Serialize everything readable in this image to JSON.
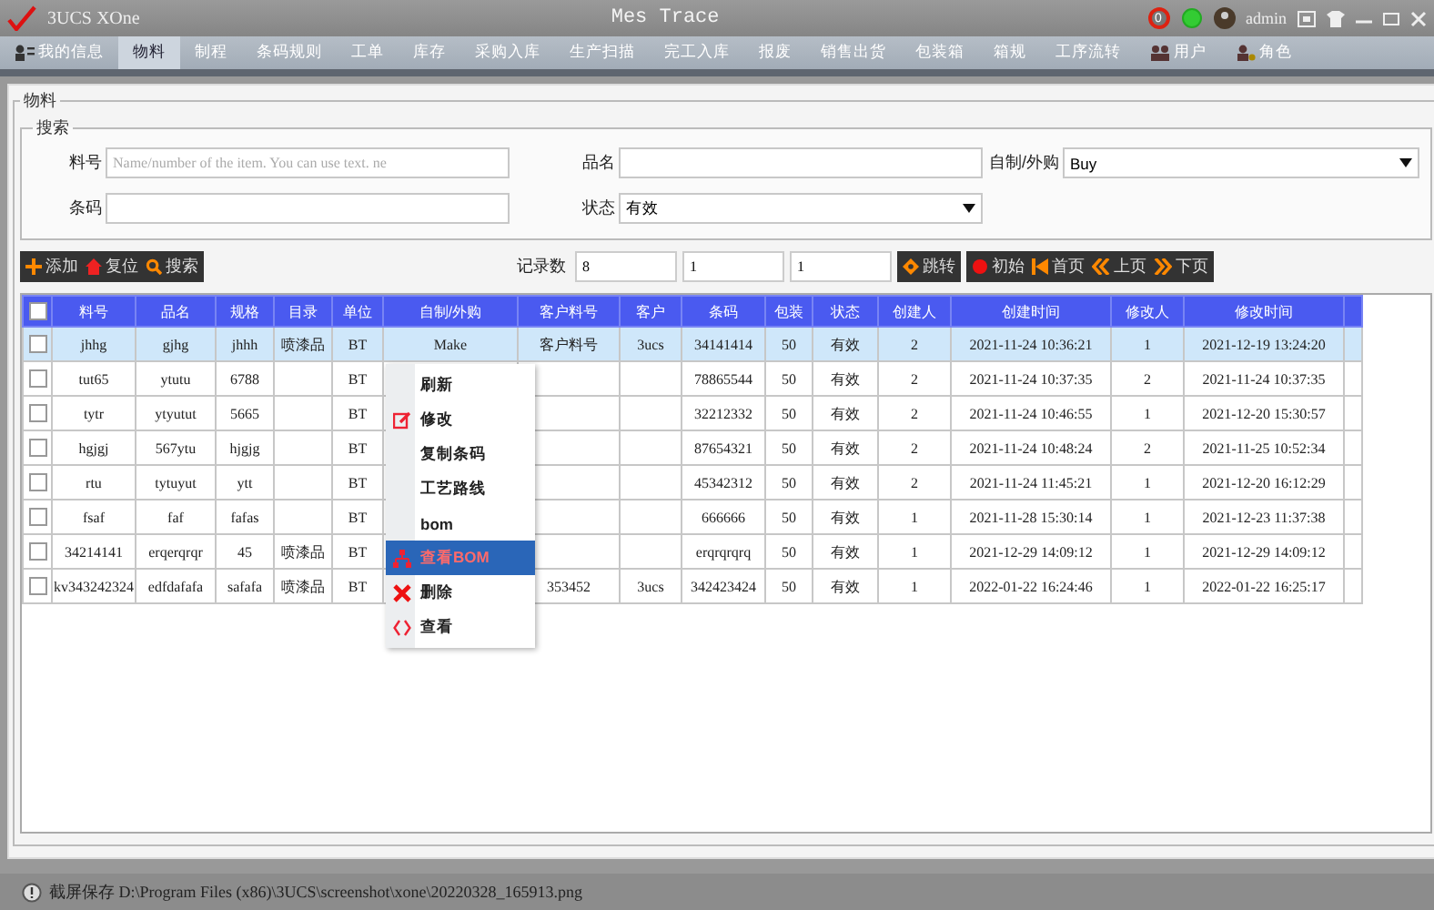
{
  "window": {
    "app_name": "3UCS XOne",
    "title": "Mes Trace",
    "notification_count": "0",
    "user": "admin"
  },
  "tabs": [
    {
      "label": "我的信息",
      "selected": false,
      "kind": "user"
    },
    {
      "label": "物料",
      "selected": true,
      "kind": "plain"
    },
    {
      "label": "制程",
      "selected": false,
      "kind": "plain"
    },
    {
      "label": "条码规则",
      "selected": false,
      "kind": "plain"
    },
    {
      "label": "工单",
      "selected": false,
      "kind": "plain"
    },
    {
      "label": "库存",
      "selected": false,
      "kind": "plain"
    },
    {
      "label": "采购入库",
      "selected": false,
      "kind": "plain"
    },
    {
      "label": "生产扫描",
      "selected": false,
      "kind": "plain"
    },
    {
      "label": "完工入库",
      "selected": false,
      "kind": "plain"
    },
    {
      "label": "报废",
      "selected": false,
      "kind": "plain"
    },
    {
      "label": "销售出货",
      "selected": false,
      "kind": "plain"
    },
    {
      "label": "包装箱",
      "selected": false,
      "kind": "plain"
    },
    {
      "label": "箱规",
      "selected": false,
      "kind": "plain"
    },
    {
      "label": "工序流转",
      "selected": false,
      "kind": "plain"
    },
    {
      "label": "用户",
      "selected": false,
      "kind": "users"
    },
    {
      "label": "角色",
      "selected": false,
      "kind": "role"
    }
  ],
  "panel": {
    "title": "物料",
    "search_title": "搜索",
    "fields": [
      {
        "label": "料号",
        "placeholder": "Name/number of the item. You can use text. ne",
        "kind": "text"
      },
      {
        "label": "品名",
        "kind": "text"
      },
      {
        "label": "自制/外购",
        "value": "Buy",
        "kind": "select"
      },
      {
        "label": "条码",
        "kind": "text"
      },
      {
        "label": "状态",
        "value": "有效",
        "kind": "select"
      }
    ]
  },
  "toolbar": {
    "buttons": [
      {
        "label": "添加",
        "kind": "add"
      },
      {
        "label": "复位",
        "kind": "reset"
      },
      {
        "label": "搜索",
        "kind": "search"
      }
    ],
    "record_label": "记录数",
    "record_count": "8",
    "page_size": "1",
    "page": "1",
    "jump": {
      "label": "跳转",
      "kind": "jump"
    },
    "pager": [
      {
        "label": "初始",
        "kind": "init"
      },
      {
        "label": "首页",
        "kind": "first"
      },
      {
        "label": "上页",
        "kind": "prev"
      },
      {
        "label": "下页",
        "kind": "next"
      }
    ]
  },
  "table": {
    "all_checked": false,
    "columns": [
      "料号",
      "品名",
      "规格",
      "目录",
      "单位",
      "自制/外购",
      "客户料号",
      "客户",
      "条码",
      "包装",
      "状态",
      "创建人",
      "创建时间",
      "修改人",
      "修改时间"
    ],
    "rows": [
      {
        "selected": true,
        "checked": false,
        "cells": [
          "jhhg",
          "gjhg",
          "jhhh",
          "喷漆品",
          "BT",
          "Make",
          "客户料号",
          "3ucs",
          "34141414",
          "50",
          "有效",
          "2",
          "2021-11-24 10:36:21",
          "1",
          "2021-12-19 13:24:20"
        ]
      },
      {
        "selected": false,
        "checked": false,
        "cells": [
          "tut65",
          "ytutu",
          "6788",
          null,
          "BT",
          null,
          null,
          null,
          "78865544",
          "50",
          "有效",
          "2",
          "2021-11-24 10:37:35",
          "2",
          "2021-11-24 10:37:35"
        ]
      },
      {
        "selected": false,
        "checked": false,
        "cells": [
          "tytr",
          "ytyutut",
          "5665",
          null,
          "BT",
          null,
          null,
          null,
          "32212332",
          "50",
          "有效",
          "2",
          "2021-11-24 10:46:55",
          "1",
          "2021-12-20 15:30:57"
        ]
      },
      {
        "selected": false,
        "checked": false,
        "cells": [
          "hgjgj",
          "567ytu",
          "hjgjg",
          null,
          "BT",
          null,
          null,
          null,
          "87654321",
          "50",
          "有效",
          "2",
          "2021-11-24 10:48:24",
          "2",
          "2021-11-25 10:52:34"
        ]
      },
      {
        "selected": false,
        "checked": false,
        "cells": [
          "rtu",
          "tytuyut",
          "ytt",
          null,
          "BT",
          null,
          null,
          null,
          "45342312",
          "50",
          "有效",
          "2",
          "2021-11-24 11:45:21",
          "1",
          "2021-12-20 16:12:29"
        ]
      },
      {
        "selected": false,
        "checked": false,
        "cells": [
          "fsaf",
          "faf",
          "fafas",
          null,
          "BT",
          null,
          null,
          null,
          "666666",
          "50",
          "有效",
          "1",
          "2021-11-28 15:30:14",
          "1",
          "2021-12-23 11:37:38"
        ]
      },
      {
        "selected": false,
        "checked": false,
        "cells": [
          "34214141",
          "erqerqrqr",
          "45",
          "喷漆品",
          "BT",
          null,
          null,
          null,
          "erqrqrqrq",
          "50",
          "有效",
          "1",
          "2021-12-29 14:09:12",
          "1",
          "2021-12-29 14:09:12"
        ]
      },
      {
        "selected": false,
        "checked": false,
        "cells": [
          "kv343242324",
          "edfdafafa",
          "safafa",
          "喷漆品",
          "BT",
          null,
          "353452",
          "3ucs",
          "342423424",
          "50",
          "有效",
          "1",
          "2022-01-22 16:24:46",
          "1",
          "2022-01-22 16:25:17"
        ]
      }
    ]
  },
  "context_menu": [
    {
      "label": "刷新",
      "kind": "plain",
      "selected": false
    },
    {
      "label": "修改",
      "kind": "edit",
      "selected": false
    },
    {
      "label": "复制条码",
      "kind": "plain",
      "selected": false
    },
    {
      "label": "工艺路线",
      "kind": "plain",
      "selected": false
    },
    {
      "label": "bom",
      "kind": "plain",
      "selected": false
    },
    {
      "label": "查看BOM",
      "kind": "tree",
      "selected": true
    },
    {
      "label": "删除",
      "kind": "delete",
      "selected": false
    },
    {
      "label": "查看",
      "kind": "code",
      "selected": false
    }
  ],
  "status_bar": {
    "message": "截屏保存 D:\\Program Files (x86)\\3UCS\\screenshot\\xone\\20220328_165913.png"
  }
}
